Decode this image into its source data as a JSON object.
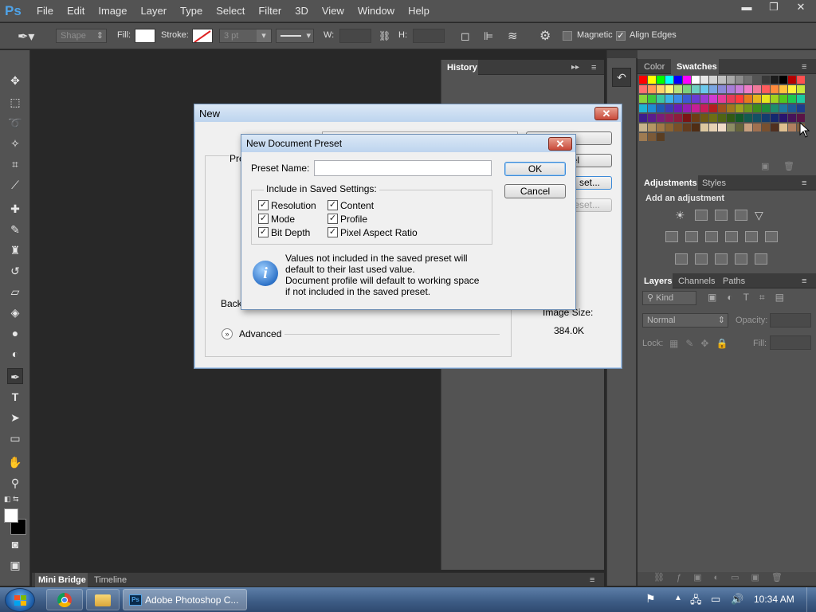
{
  "app": {
    "logo": "Ps"
  },
  "menu": [
    "File",
    "Edit",
    "Image",
    "Layer",
    "Type",
    "Select",
    "Filter",
    "3D",
    "View",
    "Window",
    "Help"
  ],
  "window_controls": {
    "minimize": "▬",
    "restore": "❐",
    "close": "✕"
  },
  "options_bar": {
    "shape_mode": "Shape",
    "fill_label": "Fill:",
    "stroke_label": "Stroke:",
    "stroke_width": "3 pt",
    "w_label": "W:",
    "h_label": "H:",
    "magnetic_label": "Magnetic",
    "align_edges_label": "Align Edges",
    "align_edges_checked": true
  },
  "history_panel": {
    "title": "History"
  },
  "color_panel": {
    "tabs": [
      "Color",
      "Swatches"
    ]
  },
  "adjustments_panel": {
    "tabs": [
      "Adjustments",
      "Styles"
    ],
    "subtitle": "Add an adjustment"
  },
  "layers_panel": {
    "tabs": [
      "Layers",
      "Channels",
      "Paths"
    ],
    "filter_kind": "Kind",
    "blend_mode": "Normal",
    "opacity_label": "Opacity:",
    "lock_label": "Lock:",
    "fill_label": "Fill:"
  },
  "bottom_tabs": [
    "Mini Bridge",
    "Timeline"
  ],
  "new_dialog": {
    "title": "New",
    "partial_preset_label": "Pre",
    "partial_cancel": "el",
    "partial_save_preset": "set...",
    "partial_delete_preset": "eset...",
    "partial_background_label": "Back",
    "advanced_label": "Advanced",
    "image_size_label": "Image Size:",
    "image_size_value": "384.0K"
  },
  "preset_dialog": {
    "title": "New Document Preset",
    "preset_name_label": "Preset Name:",
    "preset_name_value": "",
    "ok_label": "OK",
    "cancel_label": "Cancel",
    "group_label": "Include in Saved Settings:",
    "options_left": [
      "Resolution",
      "Mode",
      "Bit Depth"
    ],
    "options_right": [
      "Content",
      "Profile",
      "Pixel Aspect Ratio"
    ],
    "info_line1": "Values not included in the saved preset will",
    "info_line2": "default to their last used value.",
    "info_line3": "Document profile will default to working space",
    "info_line4": "if not included in the saved preset."
  },
  "taskbar": {
    "active_app": "Adobe Photoshop C...",
    "clock": "10:34 AM"
  },
  "colors": {
    "accent": "#4fa3e8",
    "panel": "#535353",
    "canvas": "#282828"
  }
}
